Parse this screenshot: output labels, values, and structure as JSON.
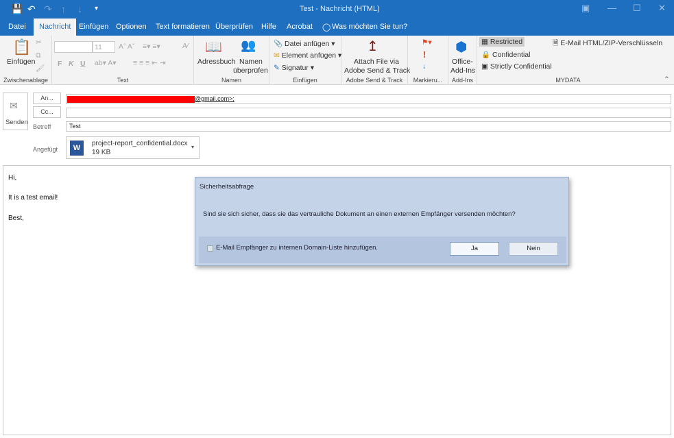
{
  "window": {
    "title": "Test  -  Nachricht (HTML)"
  },
  "quick_access": {
    "save": "save-icon",
    "undo": "undo-icon",
    "redo": "redo-icon",
    "up": "arrow-up-icon",
    "down": "arrow-down-icon",
    "customize": "customize-icon"
  },
  "tabs": [
    "Datei",
    "Nachricht",
    "Einfügen",
    "Optionen",
    "Text formatieren",
    "Überprüfen",
    "Hilfe",
    "Acrobat",
    "Was möchten Sie tun?"
  ],
  "ribbon": {
    "clipboard": {
      "paste": "Einfügen",
      "label": "Zwischenablage"
    },
    "text": {
      "font_size": "11",
      "bold": "F",
      "italic": "K",
      "underline": "U",
      "label": "Text"
    },
    "names": {
      "addressbook": "Adressbuch",
      "check_names_1": "Namen",
      "check_names_2": "überprüfen",
      "label": "Namen"
    },
    "include": {
      "attach_file": "Datei anfügen",
      "attach_item": "Element anfügen",
      "signature": "Signatur",
      "label": "Einfügen"
    },
    "adobe": {
      "attach_1": "Attach File via",
      "attach_2": "Adobe Send & Track",
      "label": "Adobe Send & Track"
    },
    "tags": {
      "label": "Markieru..."
    },
    "addins": {
      "office_1": "Office-",
      "office_2": "Add-Ins",
      "label": "Add-Ins"
    },
    "mydata": {
      "restricted": "Restricted",
      "confidential": "Confidential",
      "strictly": "Strictly Confidential",
      "encrypt": "E-Mail HTML/ZIP-Verschlüsseln",
      "label": "MYDATA"
    }
  },
  "header": {
    "send": "Senden",
    "to_button": "An...",
    "to_value": "@gmail.com>;",
    "cc_button": "Cc...",
    "subject_label": "Betreff",
    "subject_value": "Test",
    "attached_label": "Angefügt",
    "attachment": {
      "name": "project-report_confidential.docx",
      "size": "19 KB"
    }
  },
  "body": {
    "lines": [
      "Hi,",
      "It is a test email!",
      "Best,"
    ]
  },
  "dialog": {
    "title": "Sicherheitsabfrage",
    "message": "Sind sie sich sicher, dass sie das vertrauliche Dokument an einen externen Empfänger versenden möchten?",
    "checkbox_label": "E-Mail Empfänger zu internen Domain-Liste hinzufügen.",
    "checkbox_checked": false,
    "yes": "Ja",
    "no": "Nein"
  },
  "colors": {
    "accent": "#1e6fc0",
    "redaction": "#ff0000",
    "dialog_bg": "#c4d3e8"
  }
}
